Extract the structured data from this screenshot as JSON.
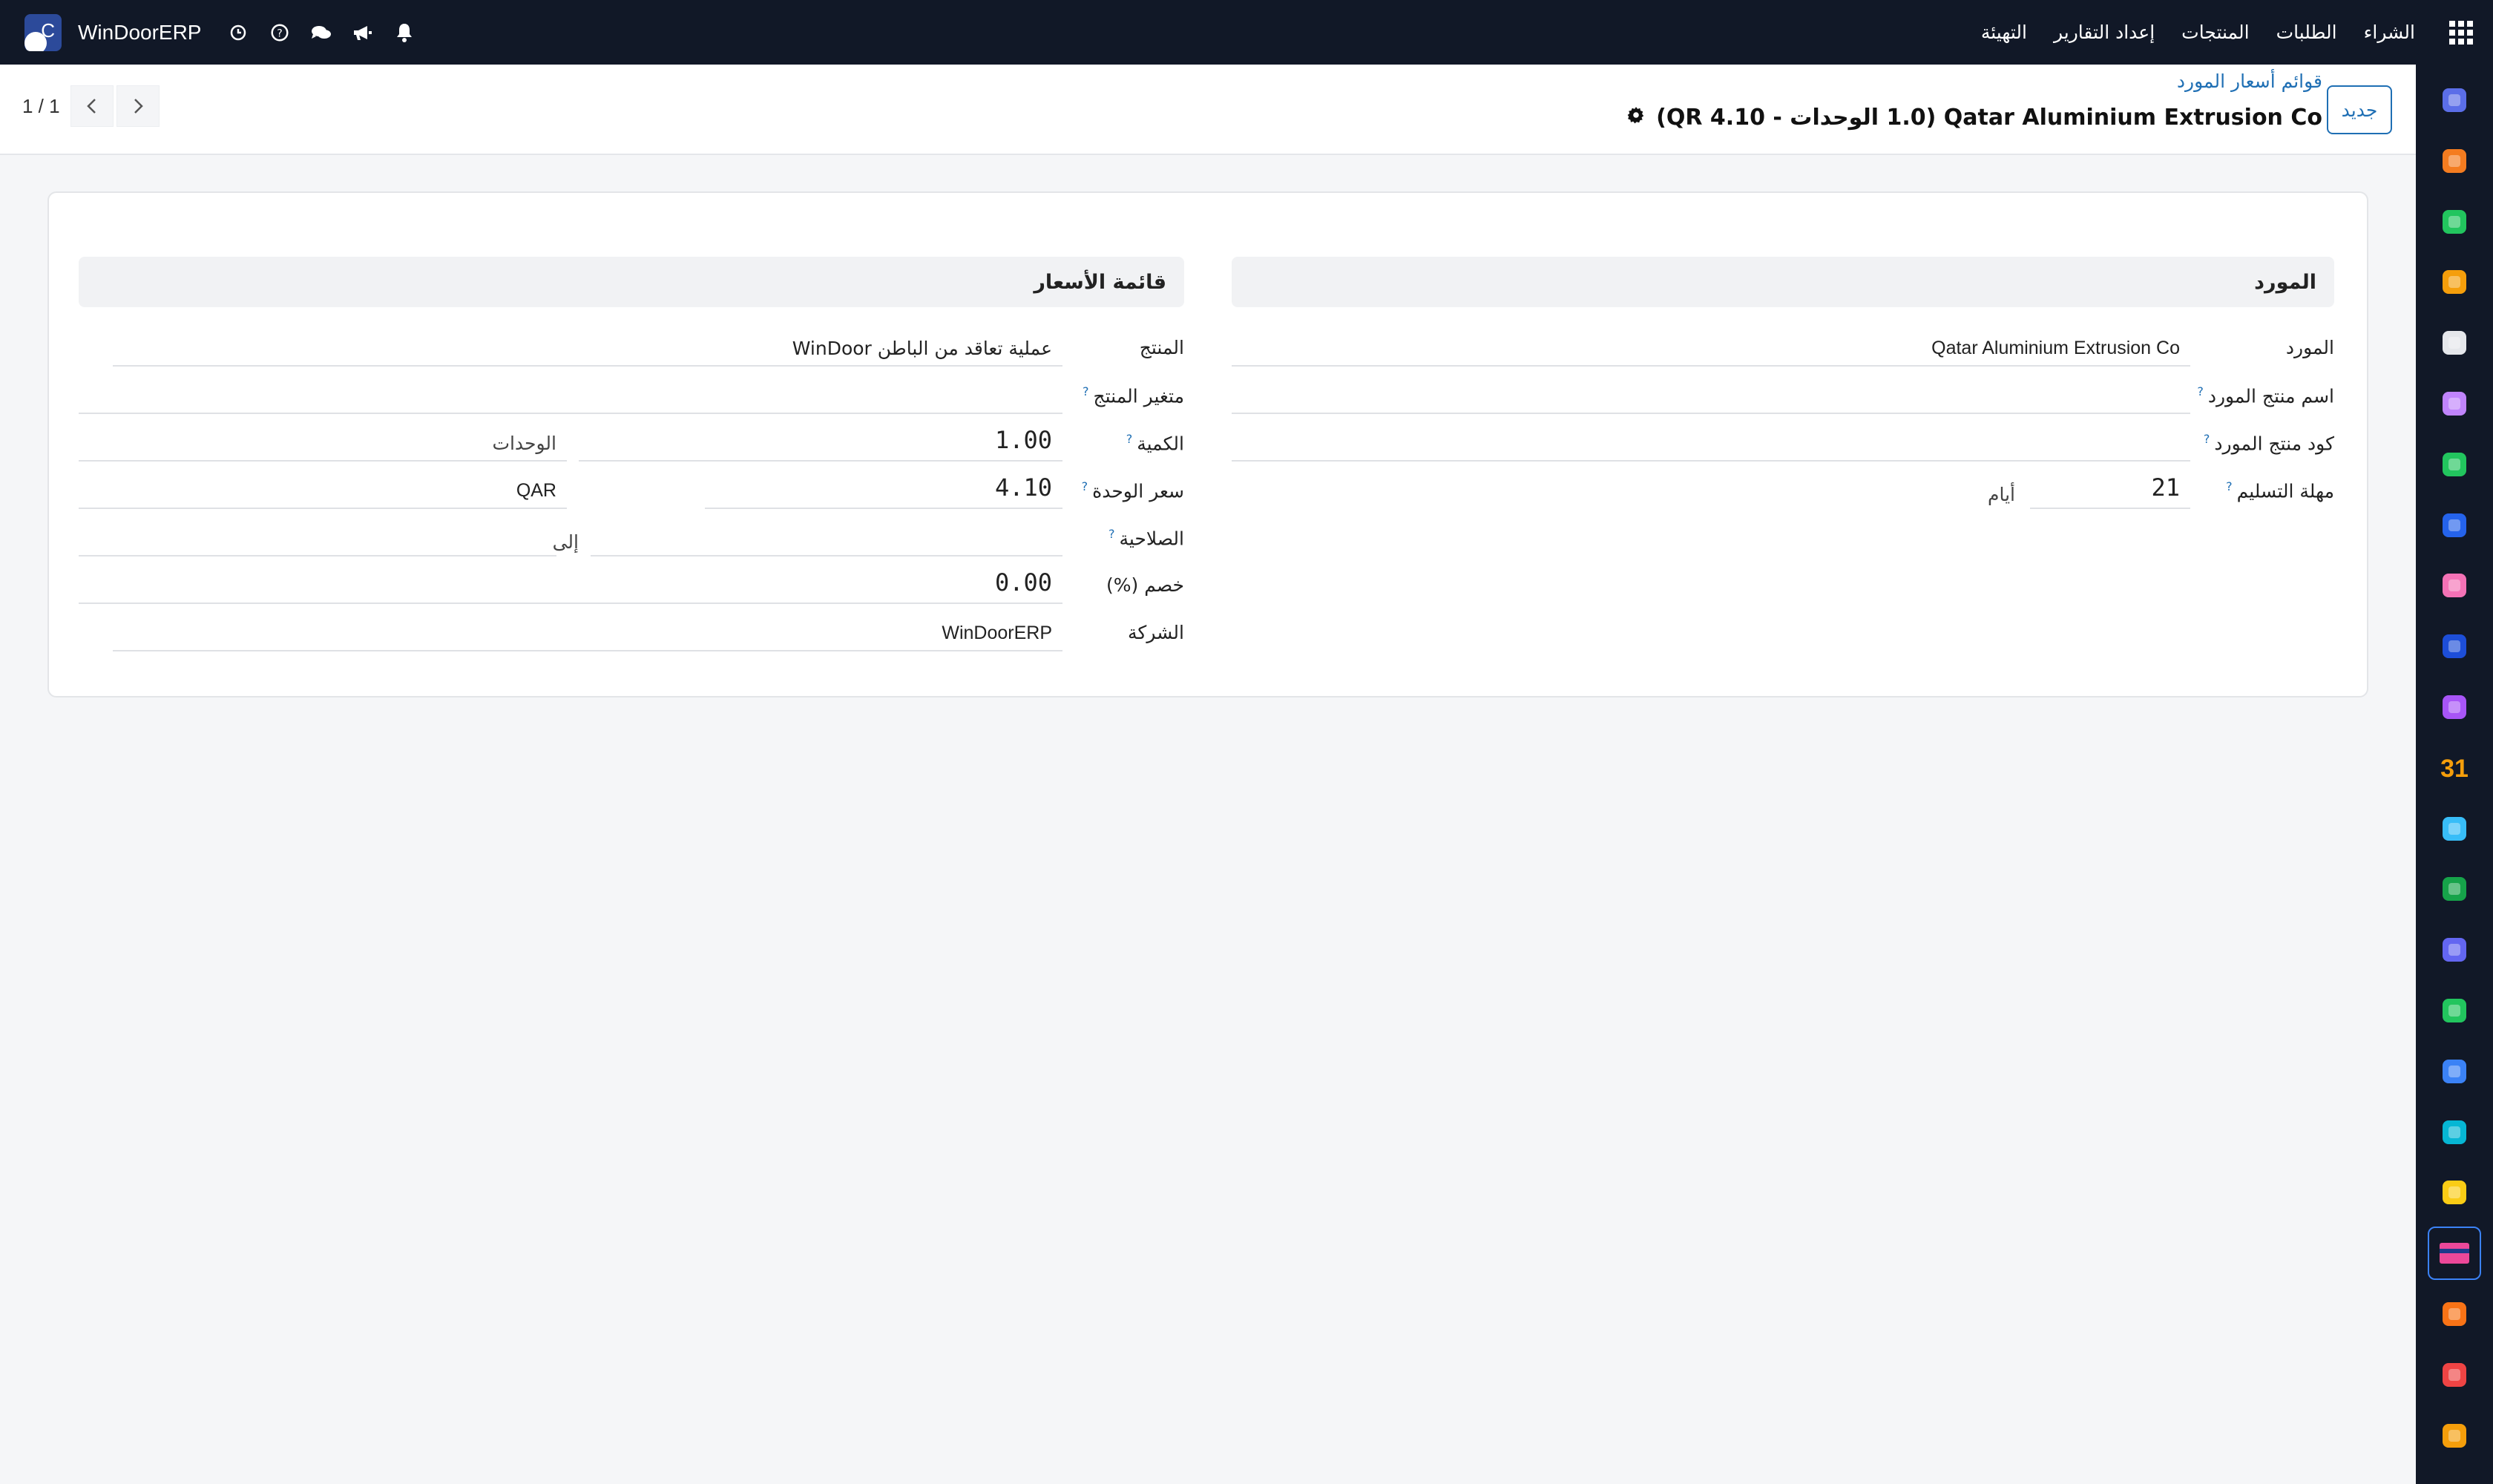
{
  "navbar": {
    "menu": [
      "الشراء",
      "الطلبات",
      "المنتجات",
      "إعداد التقارير",
      "التهيئة"
    ],
    "brand": "WinDoorERP",
    "avatar_letter": "C",
    "icons": [
      "clock-icon",
      "help-icon",
      "chat-icon",
      "megaphone-icon",
      "bell-icon"
    ]
  },
  "control_panel": {
    "breadcrumb": "قوائم أسعار المورد",
    "title": "Qatar Aluminium Extrusion Co (1.0 الوحدات - QR 4.10)",
    "new_button": "جديد",
    "pager": "1 / 1"
  },
  "form": {
    "vendor_group": {
      "title": "المورد",
      "vendor_label": "المورد",
      "vendor_value": "Qatar Aluminium Extrusion Co",
      "vendor_product_name_label": "اسم منتج المورد",
      "vendor_product_name_value": "",
      "vendor_product_code_label": "كود منتج المورد",
      "vendor_product_code_value": "",
      "lead_time_label": "مهلة التسليم",
      "lead_time_value": "21",
      "lead_time_unit": "أيام"
    },
    "pricelist_group": {
      "title": "قائمة الأسعار",
      "product_label": "المنتج",
      "product_value": "عملية تعاقد من الباطن WinDoor",
      "variant_label": "متغير المنتج",
      "variant_value": "",
      "quantity_label": "الكمية",
      "quantity_value": "1.00",
      "quantity_uom": "الوحدات",
      "unit_price_label": "سعر الوحدة",
      "unit_price_value": "4.10",
      "currency": "QAR",
      "validity_label": "الصلاحية",
      "validity_to": "إلى",
      "discount_label": "خصم (%)",
      "discount_value": "0.00",
      "company_label": "الشركة",
      "company_value": "WinDoorERP"
    }
  },
  "appbar": {
    "active_index": 19,
    "icons": [
      "gmail-icon",
      "chat-bubble-icon",
      "discuss-icon",
      "bar-chart-icon",
      "cube-icon",
      "photo-icon",
      "check-icon",
      "book-icon",
      "box-icon",
      "dollar-doc-icon",
      "team-icon",
      "calendar-31-icon",
      "pen-icon",
      "contact-card-icon",
      "dashboard-icon",
      "whatsapp-icon",
      "compass-icon",
      "wave-icon",
      "send-icon",
      "credit-card-icon",
      "package-icon",
      "pie-chart-icon",
      "hexagon-icon"
    ]
  },
  "colors": {
    "navbar": "#111827",
    "accent": "#1f6fb4",
    "background": "#f5f6f8"
  }
}
